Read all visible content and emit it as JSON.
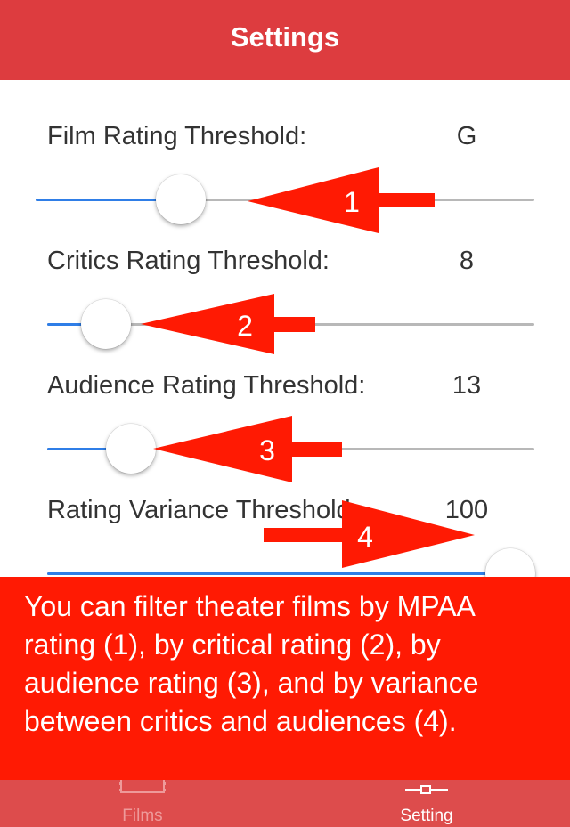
{
  "nav": {
    "title": "Settings"
  },
  "sliders": [
    {
      "label": "Film Rating Threshold:",
      "value": "G",
      "level_fraction": 0.29
    },
    {
      "label": "Critics Rating Threshold:",
      "value": "8",
      "level_fraction": 0.12
    },
    {
      "label": "Audience Rating Threshold:",
      "value": "13",
      "level_fraction": 0.17
    },
    {
      "label": "Rating Variance Threshold:",
      "value": "100",
      "level_fraction": 1.0
    }
  ],
  "annotations": [
    "1",
    "2",
    "3",
    "4"
  ],
  "overlay": {
    "text": "You can filter theater films by MPAA rating (1), by critical rating (2), by audience rating (3), and by variance between critics and audiences (4)."
  },
  "tabbar": {
    "tabs": [
      {
        "label": "Films",
        "icon": "films-icon"
      },
      {
        "label": "Setting",
        "icon": "settings-slider-icon"
      }
    ]
  },
  "colors": {
    "nav_bg": "#dd3c3f",
    "accent_blue": "#2f7ee7",
    "annotation_red": "#ff1a03",
    "tabbar_bg": "#dd4c4c"
  }
}
